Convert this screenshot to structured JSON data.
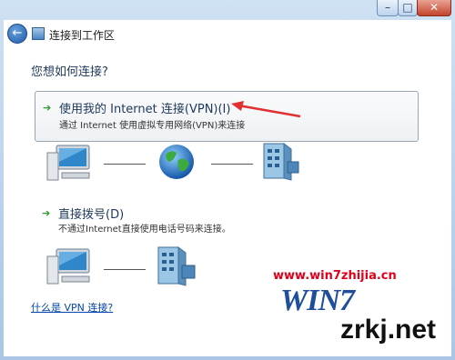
{
  "window": {
    "min_glyph": "–",
    "max_glyph": "□",
    "close_glyph": "✕"
  },
  "nav": {
    "back_glyph": "←",
    "title": "连接到工作区"
  },
  "heading": "您想如何连接?",
  "options": [
    {
      "title": "使用我的 Internet 连接(VPN)(I)",
      "description": "通过 Internet 使用虚拟专用网络(VPN)来连接",
      "arrow": "➔"
    },
    {
      "title": "直接拨号(D)",
      "description": "不通过Internet直接使用电话号码来连接。",
      "arrow": "➔"
    }
  ],
  "help_link": "什么是 VPN 连接?",
  "watermark": {
    "url": "www.win7zhijia.cn",
    "logo": "WIN7",
    "site": "zrkj.net"
  },
  "colors": {
    "link": "#0645ad",
    "heading": "#1e395b",
    "annotation_arrow": "#e03030",
    "option_arrow": "#2c9a2c"
  },
  "icons": [
    "back-arrow-icon",
    "workplace-icon",
    "computer-icon",
    "globe-icon",
    "server-icon",
    "phone-server-icon"
  ]
}
